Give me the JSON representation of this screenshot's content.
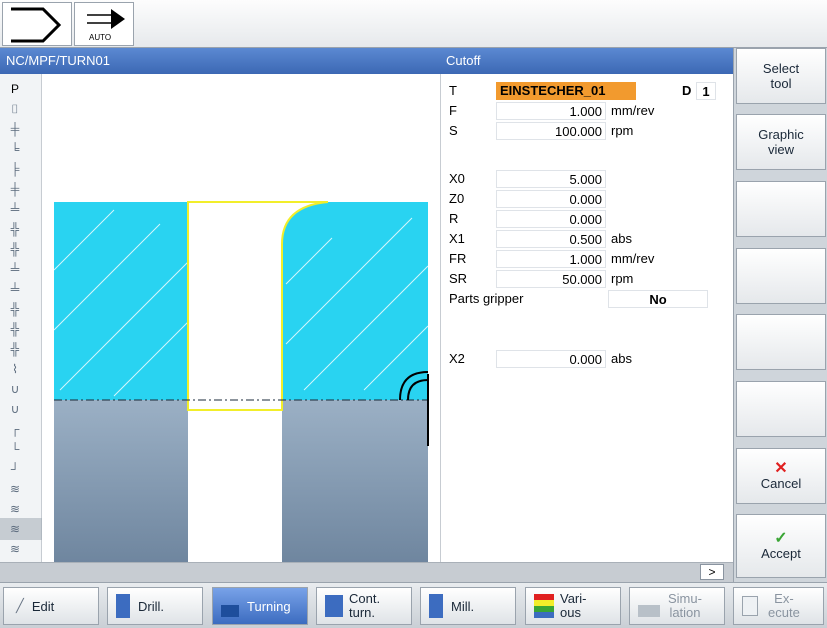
{
  "header": {
    "path": "NC/MPF/TURN01",
    "cycle_title": "Cutoff"
  },
  "top": {
    "mode_label": "AUTO"
  },
  "params": {
    "T_label": "T",
    "T_value": "EINSTECHER_01",
    "D_label": "D",
    "D_value": "1",
    "F_label": "F",
    "F_value": "1.000",
    "F_unit": "mm/rev",
    "S_label": "S",
    "S_value": "100.000",
    "S_unit": "rpm",
    "X0_label": "X0",
    "X0_value": "5.000",
    "Z0_label": "Z0",
    "Z0_value": "0.000",
    "R_label": "R",
    "R_value": "0.000",
    "X1_label": "X1",
    "X1_value": "0.500",
    "X1_unit": "abs",
    "FR_label": "FR",
    "FR_value": "1.000",
    "FR_unit": "mm/rev",
    "SR_label": "SR",
    "SR_value": "50.000",
    "SR_unit": "rpm",
    "gripper_label": "Parts gripper",
    "gripper_value": "No",
    "X2_label": "X2",
    "X2_value": "0.000",
    "X2_unit": "abs"
  },
  "strip": {
    "first": "P"
  },
  "softkeys": {
    "select_tool_1": "Select",
    "select_tool_2": "tool",
    "graphic_view_1": "Graphic",
    "graphic_view_2": "view",
    "cancel": "Cancel",
    "accept": "Accept"
  },
  "more_label": ">",
  "bottom": {
    "edit": "Edit",
    "drill": "Drill.",
    "turning": "Turning",
    "cont_turn_1": "Cont.",
    "cont_turn_2": "turn.",
    "mill": "Mill.",
    "various_1": "Vari-",
    "various_2": "ous",
    "simulation_1": "Simu-",
    "simulation_2": "lation",
    "execute_1": "Ex-",
    "execute_2": "ecute"
  },
  "colors": {
    "header_blue": "#3c68b4",
    "tool_orange": "#f29a2e",
    "stock_cyan": "#29d3f1",
    "contour_yellow": "#f2ee2a",
    "cancel_red": "#e02020",
    "accept_green": "#3aa535",
    "active_tab": "#3c6cc0"
  }
}
